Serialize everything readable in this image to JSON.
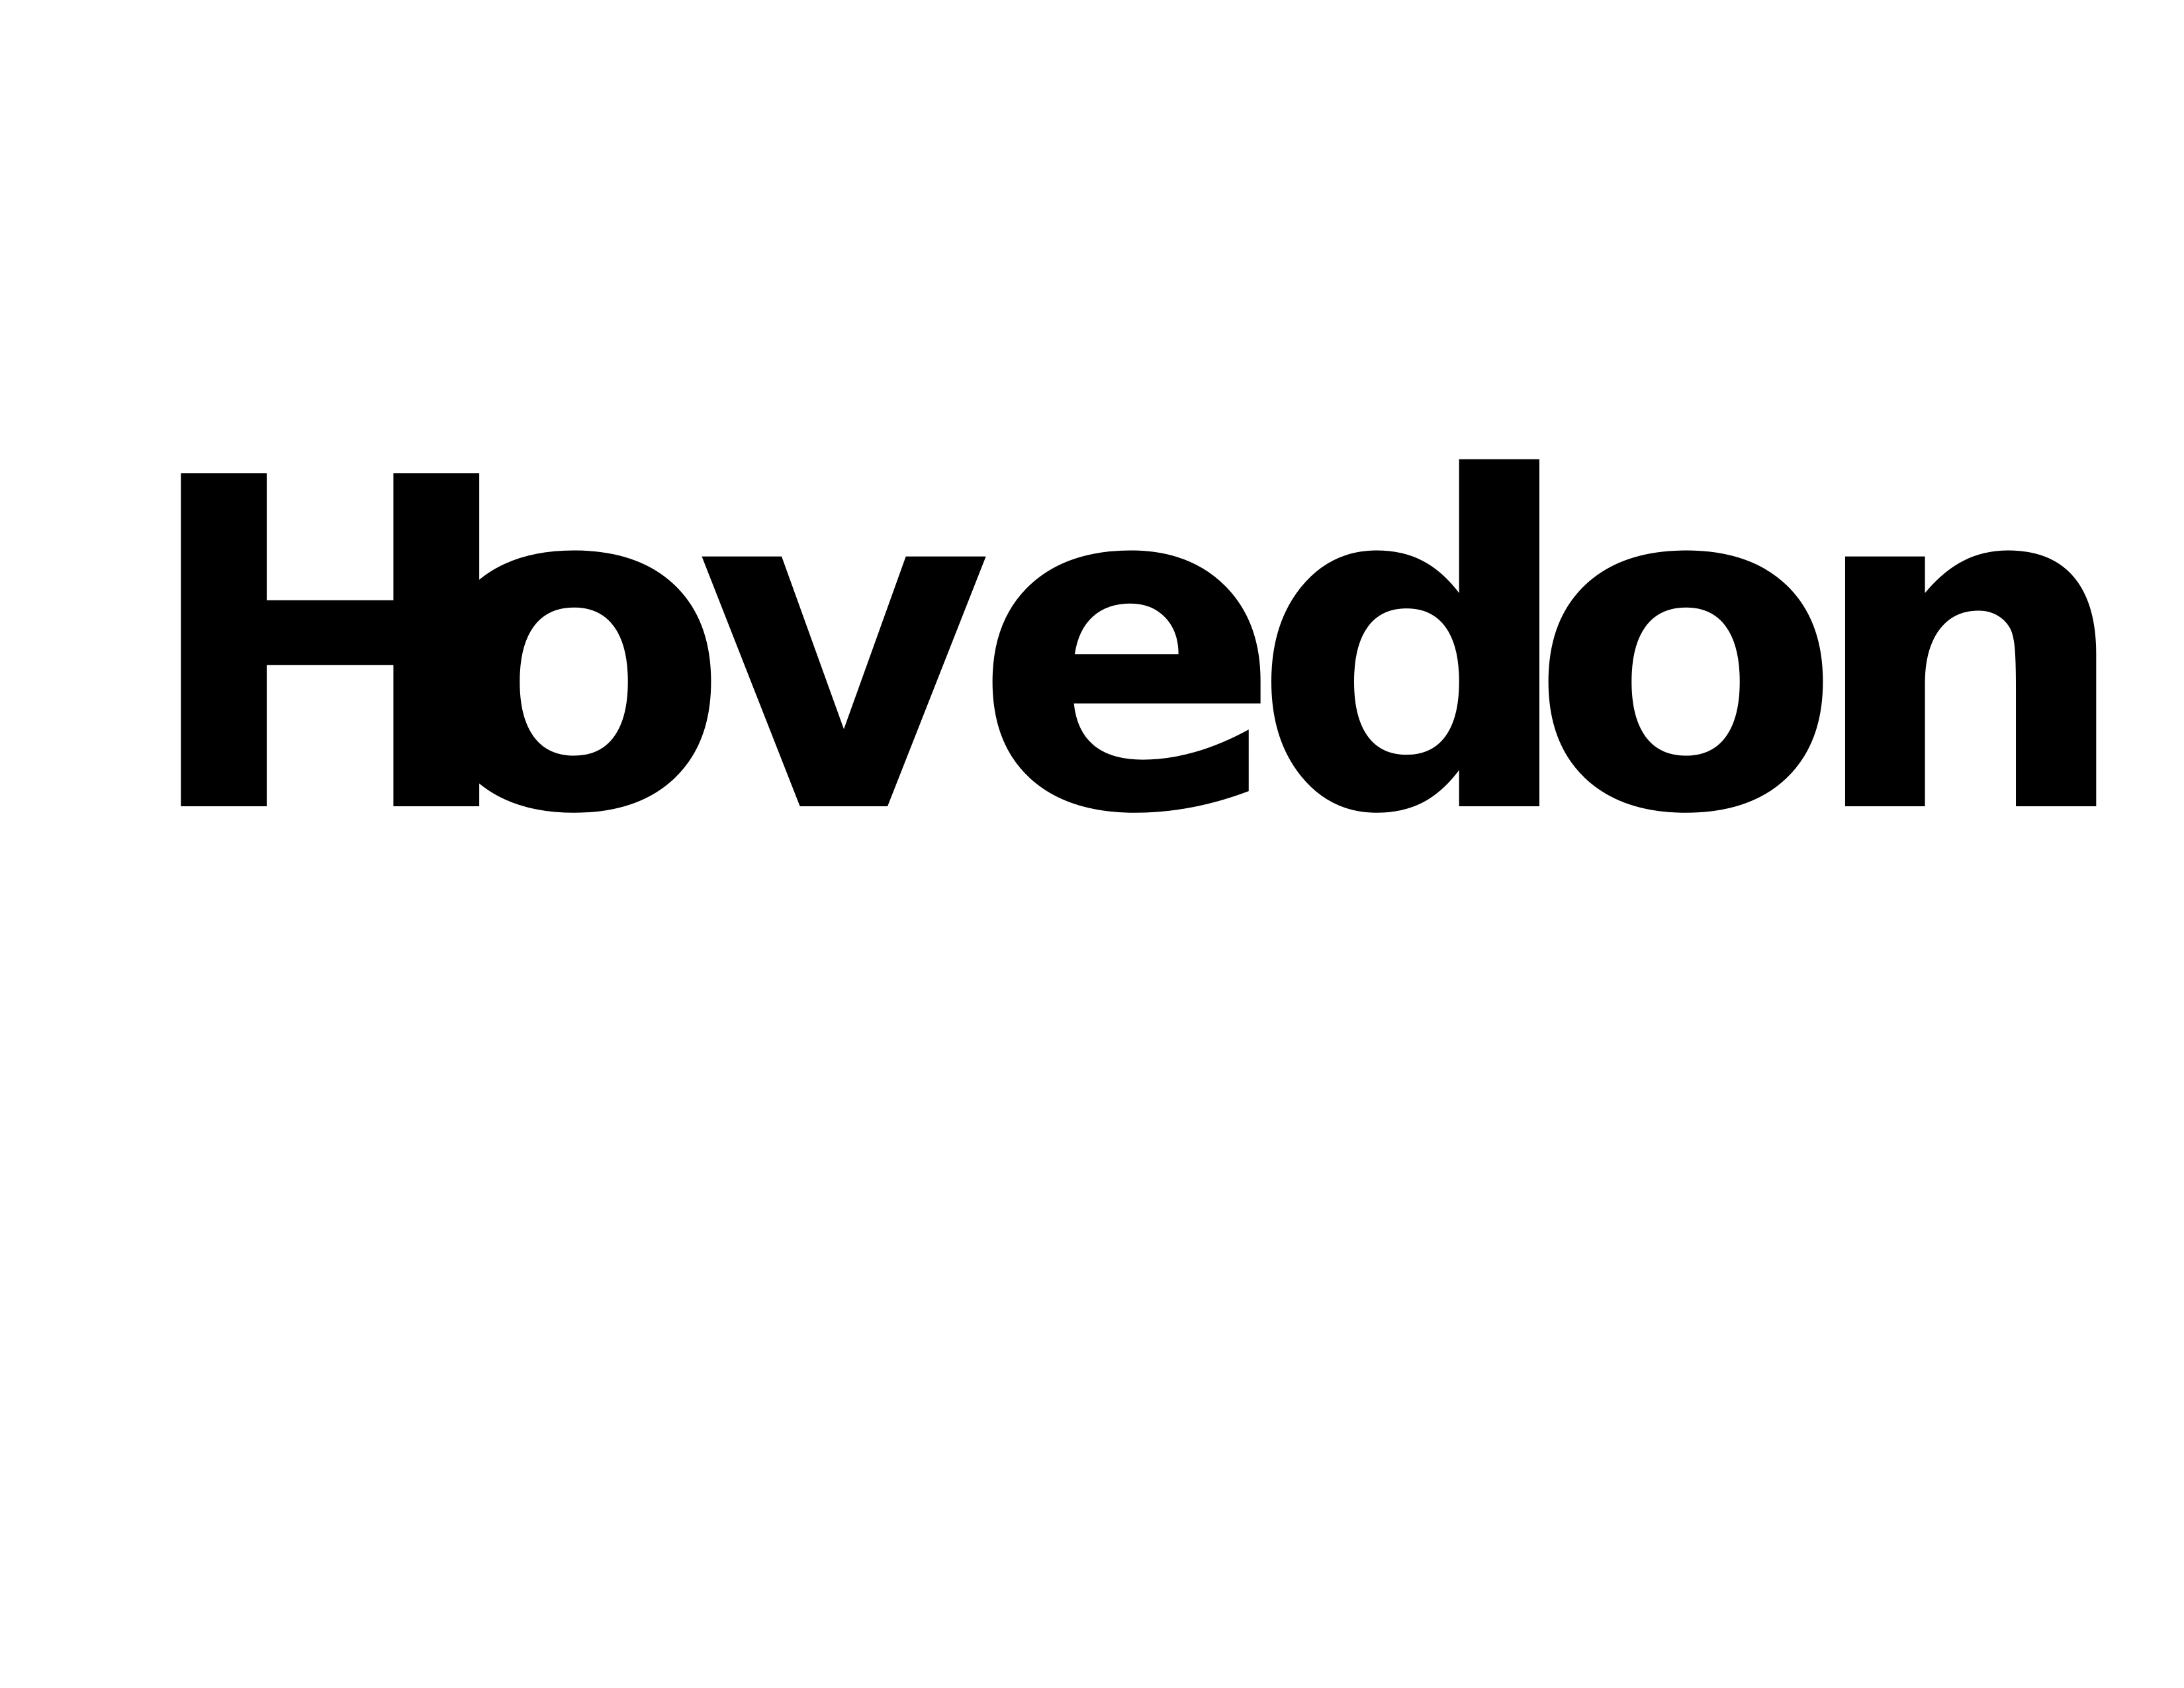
{
  "title": {
    "text": "Hovedon",
    "letters": [
      "H",
      "o",
      "v",
      "e",
      "d",
      "o",
      "n"
    ]
  },
  "colors": {
    "background": "#ffffff",
    "text": "#000000"
  }
}
